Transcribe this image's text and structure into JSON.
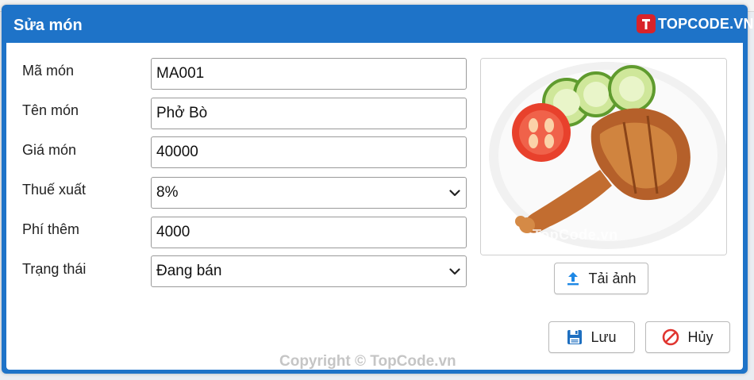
{
  "dialog": {
    "title": "Sửa món",
    "logo_text": "TOPCODE.VN",
    "watermark": "TopCode.vn",
    "copyright": "Copyright © TopCode.vn"
  },
  "form": {
    "ma_mon": {
      "label": "Mã món",
      "value": "MA001"
    },
    "ten_mon": {
      "label": "Tên món",
      "value": "Phở Bò"
    },
    "gia_mon": {
      "label": "Giá món",
      "value": "40000"
    },
    "thue_xuat": {
      "label": "Thuế xuất",
      "value": "8%"
    },
    "phi_them": {
      "label": "Phí thêm",
      "value": "4000"
    },
    "trang_thai": {
      "label": "Trạng thái",
      "value": "Đang bán"
    }
  },
  "buttons": {
    "upload": "Tải ảnh",
    "save": "Lưu",
    "cancel": "Hủy"
  },
  "colors": {
    "titlebar": "#1e73c8",
    "upload_icon": "#1e88e5",
    "save_icon": "#1e6fc0",
    "cancel_icon": "#e0342f"
  }
}
